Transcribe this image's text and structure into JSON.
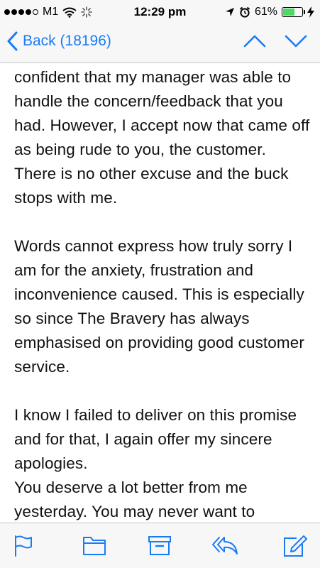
{
  "status_bar": {
    "carrier": "M1",
    "time": "12:29 pm",
    "battery_percent": "61%",
    "battery_level": 0.61,
    "signal_bars": 4,
    "signal_max": 5,
    "icons": [
      "wifi-icon",
      "activity-icon",
      "location-icon",
      "alarm-icon",
      "charging-icon"
    ]
  },
  "nav": {
    "back_label": "Back (18196)",
    "icons": [
      "chevron-left-icon",
      "chevron-up-icon",
      "chevron-down-icon"
    ]
  },
  "email": {
    "paragraphs": [
      "confident that my manager was able to handle the concern/feedback that you had. However, I accept now that came off as being rude to you, the customer. There is no other excuse and the buck stops with me.",
      "Words cannot express how truly sorry I am for the anxiety, frustration and inconvenience caused. This is especially so since The Bravery has always emphasised on providing good customer service.",
      "I know I failed to deliver on this promise and for that, I again offer my sincere apologies.",
      "You deserve a lot better from me yesterday. You may never want to"
    ]
  },
  "toolbar": {
    "icons": [
      "flag-icon",
      "folder-icon",
      "archive-icon",
      "reply-icon",
      "compose-icon"
    ]
  },
  "colors": {
    "accent": "#1a7cf4",
    "bar_background": "#f7f7f7",
    "battery": "#4cd964",
    "text": "#111111"
  }
}
